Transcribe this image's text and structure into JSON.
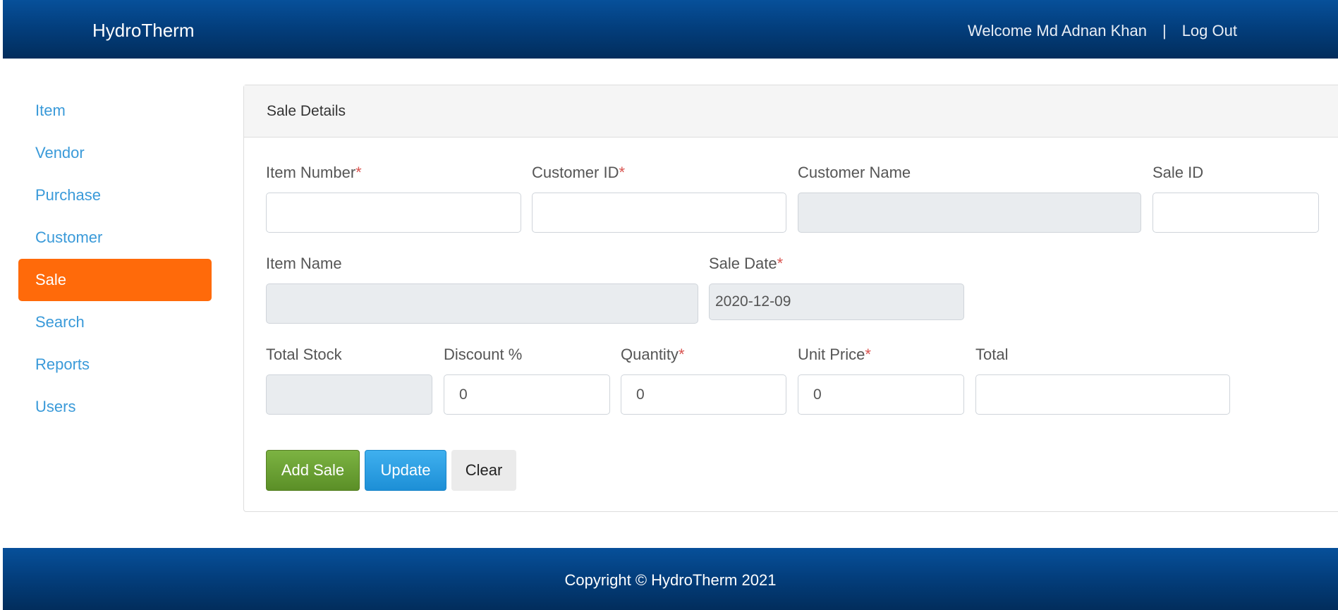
{
  "header": {
    "brand": "HydroTherm",
    "welcome": "Welcome Md Adnan Khan",
    "separator": "|",
    "logout": "Log Out"
  },
  "sidebar": {
    "items": [
      {
        "label": "Item"
      },
      {
        "label": "Vendor"
      },
      {
        "label": "Purchase"
      },
      {
        "label": "Customer"
      },
      {
        "label": "Sale",
        "active": true
      },
      {
        "label": "Search"
      },
      {
        "label": "Reports"
      },
      {
        "label": "Users"
      }
    ]
  },
  "panel": {
    "title": "Sale Details",
    "required_mark": "*",
    "fields": {
      "item_number": {
        "label": "Item Number",
        "value": ""
      },
      "customer_id": {
        "label": "Customer ID",
        "value": ""
      },
      "customer_name": {
        "label": "Customer Name",
        "value": ""
      },
      "sale_id": {
        "label": "Sale ID",
        "value": ""
      },
      "item_name": {
        "label": "Item Name",
        "value": ""
      },
      "sale_date": {
        "label": "Sale Date",
        "value": "2020-12-09"
      },
      "total_stock": {
        "label": "Total Stock",
        "value": ""
      },
      "discount": {
        "label": "Discount %",
        "value": "0"
      },
      "quantity": {
        "label": "Quantity",
        "value": "0"
      },
      "unit_price": {
        "label": "Unit Price",
        "value": "0"
      },
      "total": {
        "label": "Total",
        "value": ""
      }
    },
    "buttons": {
      "add": "Add Sale",
      "update": "Update",
      "clear": "Clear"
    }
  },
  "footer": {
    "copyright": "Copyright © HydroTherm 2021"
  },
  "colors": {
    "header_blue": "#033f7e",
    "active_nav": "#ff6a0a",
    "link_blue": "#3a9ad9",
    "required_red": "#d9534f",
    "add_green": "#6ea33a",
    "update_blue": "#2a9fe3"
  }
}
